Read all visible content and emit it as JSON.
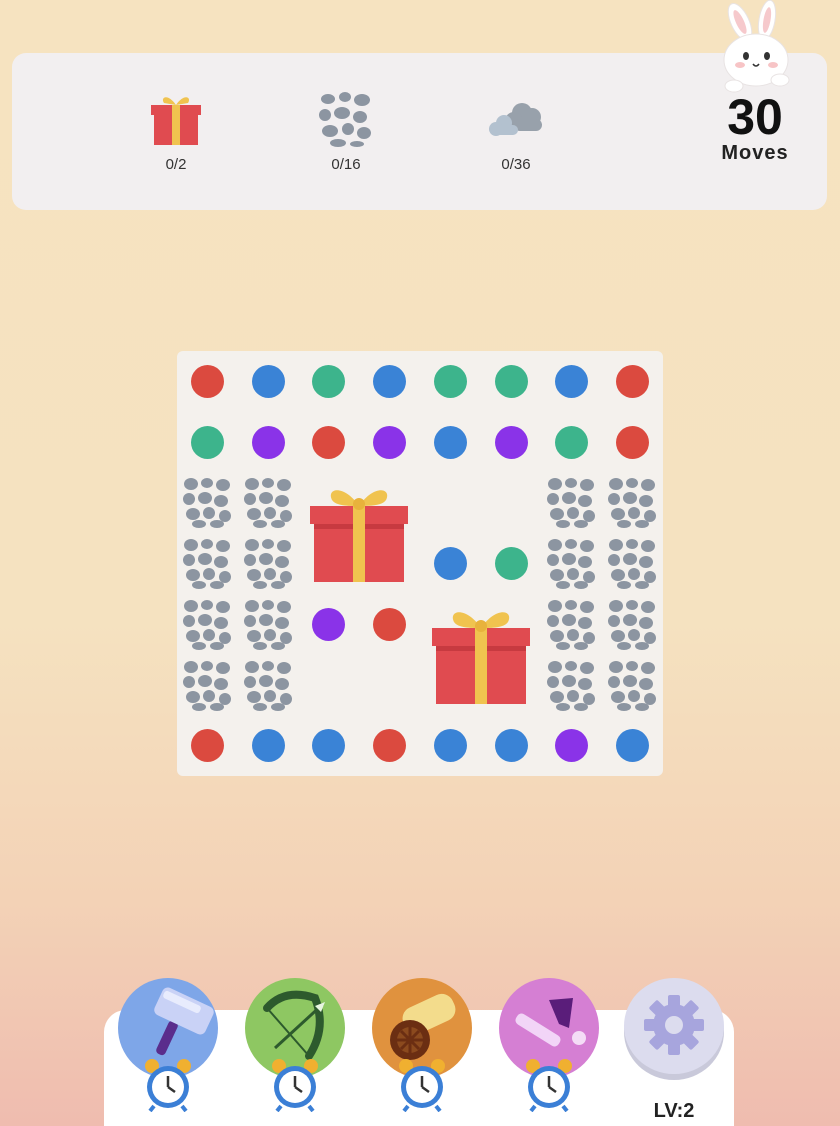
{
  "goals": [
    {
      "icon": "gift-icon",
      "count": "0/2"
    },
    {
      "icon": "stone-icon",
      "count": "0/16"
    },
    {
      "icon": "cloud-icon",
      "count": "0/36"
    }
  ],
  "moves": {
    "value": "30",
    "label": "Moves"
  },
  "colors": {
    "red": "#db4a3f",
    "blue": "#3a83d6",
    "green": "#3db48c",
    "purple": "#8a33e8",
    "stone": "#8c95a1",
    "gift_red": "#e04b50",
    "gift_ribbon": "#f0c34f"
  },
  "board": {
    "rows": [
      [
        "red",
        "blue",
        "green",
        "blue",
        "green",
        "green",
        "blue",
        "red"
      ],
      [
        "green",
        "purple",
        "red",
        "purple",
        "blue",
        "purple",
        "green",
        "red"
      ],
      [
        "stone",
        "stone",
        "gift",
        "gift",
        "empty",
        "empty",
        "stone",
        "stone"
      ],
      [
        "stone",
        "stone",
        "gift",
        "gift",
        "blue",
        "green",
        "stone",
        "stone"
      ],
      [
        "stone",
        "stone",
        "purple",
        "red",
        "gift",
        "gift",
        "stone",
        "stone"
      ],
      [
        "stone",
        "stone",
        "empty",
        "empty",
        "gift",
        "gift",
        "stone",
        "stone"
      ],
      [
        "red",
        "blue",
        "blue",
        "red",
        "blue",
        "blue",
        "purple",
        "blue"
      ]
    ]
  },
  "boosters": [
    {
      "name": "hammer-booster",
      "icon": "hammer-icon",
      "color": "#7ea6e8"
    },
    {
      "name": "bow-booster",
      "icon": "bow-arrow-icon",
      "color": "#8ec762"
    },
    {
      "name": "cannon-booster",
      "icon": "cannon-icon",
      "color": "#e0923e"
    },
    {
      "name": "wand-booster",
      "icon": "magic-wand-icon",
      "color": "#d57fd3"
    }
  ],
  "settings": {
    "icon": "gear-icon"
  },
  "level": "LV:2"
}
